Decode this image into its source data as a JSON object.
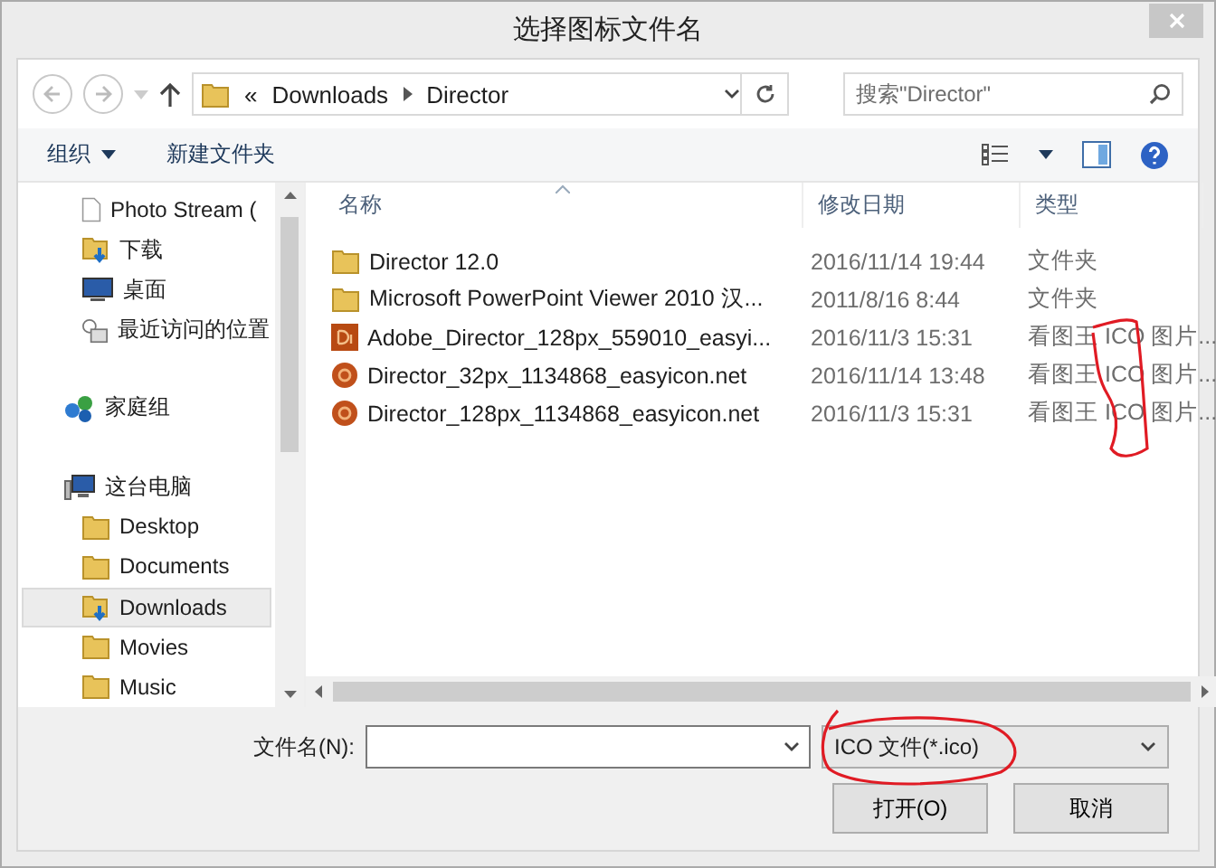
{
  "window": {
    "title": "选择图标文件名"
  },
  "address": {
    "overflow": "«",
    "crumbs": [
      "Downloads",
      "Director"
    ]
  },
  "search": {
    "placeholder": "搜索\"Director\""
  },
  "toolbar": {
    "buttons": [
      "组织",
      "新建文件夹"
    ]
  },
  "sidebar": {
    "items": [
      {
        "label": "Photo Stream (",
        "kind": "file",
        "selected": false
      },
      {
        "label": "下载",
        "kind": "download",
        "selected": false
      },
      {
        "label": "桌面",
        "kind": "desktop",
        "selected": false
      },
      {
        "label": "最近访问的位置",
        "kind": "recent",
        "selected": false
      },
      {
        "label": "家庭组",
        "kind": "homegroup",
        "selected": false
      },
      {
        "label": "这台电脑",
        "kind": "pc",
        "selected": false,
        "children": [
          {
            "label": "Desktop",
            "kind": "folder",
            "selected": false
          },
          {
            "label": "Documents",
            "kind": "folder",
            "selected": false
          },
          {
            "label": "Downloads",
            "kind": "download",
            "selected": true
          },
          {
            "label": "Movies",
            "kind": "folder",
            "selected": false
          },
          {
            "label": "Music",
            "kind": "folder",
            "selected": false
          }
        ]
      }
    ]
  },
  "table": {
    "columns": [
      "名称",
      "修改日期",
      "类型"
    ],
    "rows": [
      {
        "kind": "folder",
        "name": "Director 12.0",
        "date": "2016/11/14 19:44",
        "type": "文件夹"
      },
      {
        "kind": "folder",
        "name": "Microsoft PowerPoint Viewer 2010 汉...",
        "date": "2011/8/16 8:44",
        "type": "文件夹"
      },
      {
        "kind": "di",
        "name": "Adobe_Director_128px_559010_easyi...",
        "date": "2016/11/3 15:31",
        "type": "看图王 ICO 图片..."
      },
      {
        "kind": "ball",
        "name": "Director_32px_1134868_easyicon.net",
        "date": "2016/11/14 13:48",
        "type": "看图王 ICO 图片..."
      },
      {
        "kind": "ball",
        "name": "Director_128px_1134868_easyicon.net",
        "date": "2016/11/3 15:31",
        "type": "看图王 ICO 图片..."
      }
    ]
  },
  "filename": {
    "label": "文件名(N):"
  },
  "filter": {
    "value": "ICO 文件(*.ico)"
  },
  "buttons": [
    "打开(O)",
    "取消"
  ]
}
